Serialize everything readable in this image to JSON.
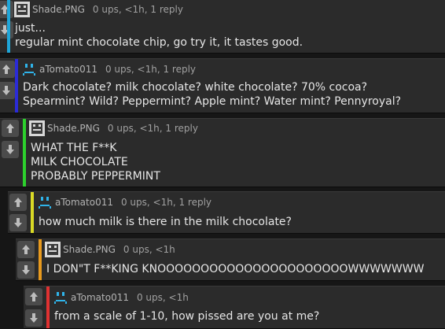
{
  "colors": {
    "level1": "#1fa6d9",
    "level2": "#2b2bd6",
    "level3": "#2dd12d",
    "level4": "#d9d926",
    "level5": "#e89a1e",
    "level6": "#e03131"
  },
  "comments": [
    {
      "author": "Shade.PNG",
      "avatar": "square-face-avatar",
      "meta": "0 ups, <1h, 1 reply",
      "lines": [
        "just...",
        "regular mint chocolate chip, go try it, it tastes good."
      ]
    },
    {
      "author": "aTomato011",
      "avatar": "blue-sad-face-avatar",
      "meta": "0 ups, <1h, 1 reply",
      "lines": [
        "Dark chocolate? milk chocolate? white chocolate? 70% cocoa?",
        "Spearmint? Wild? Peppermint? Apple mint? Water mint? Pennyroyal?"
      ]
    },
    {
      "author": "Shade.PNG",
      "avatar": "square-face-avatar",
      "meta": "0 ups, <1h, 1 reply",
      "lines": [
        "WHAT THE F**K",
        "MILK CHOCOLATE",
        "PROBABLY PEPPERMINT"
      ]
    },
    {
      "author": "aTomato011",
      "avatar": "blue-sad-face-avatar",
      "meta": "0 ups, <1h, 1 reply",
      "lines": [
        "how much milk is there in the milk chocolate?"
      ]
    },
    {
      "author": "Shade.PNG",
      "avatar": "square-face-avatar",
      "meta": "0 ups, <1h",
      "lines": [
        "I DON\"T F**KING KNOOOOOOOOOOOOOOOOOOOOOOWWWWWWW"
      ]
    },
    {
      "author": "aTomato011",
      "avatar": "blue-sad-face-avatar",
      "meta": "0 ups, <1h",
      "lines": [
        "from a scale of 1-10, how pissed are you at me?"
      ]
    }
  ]
}
